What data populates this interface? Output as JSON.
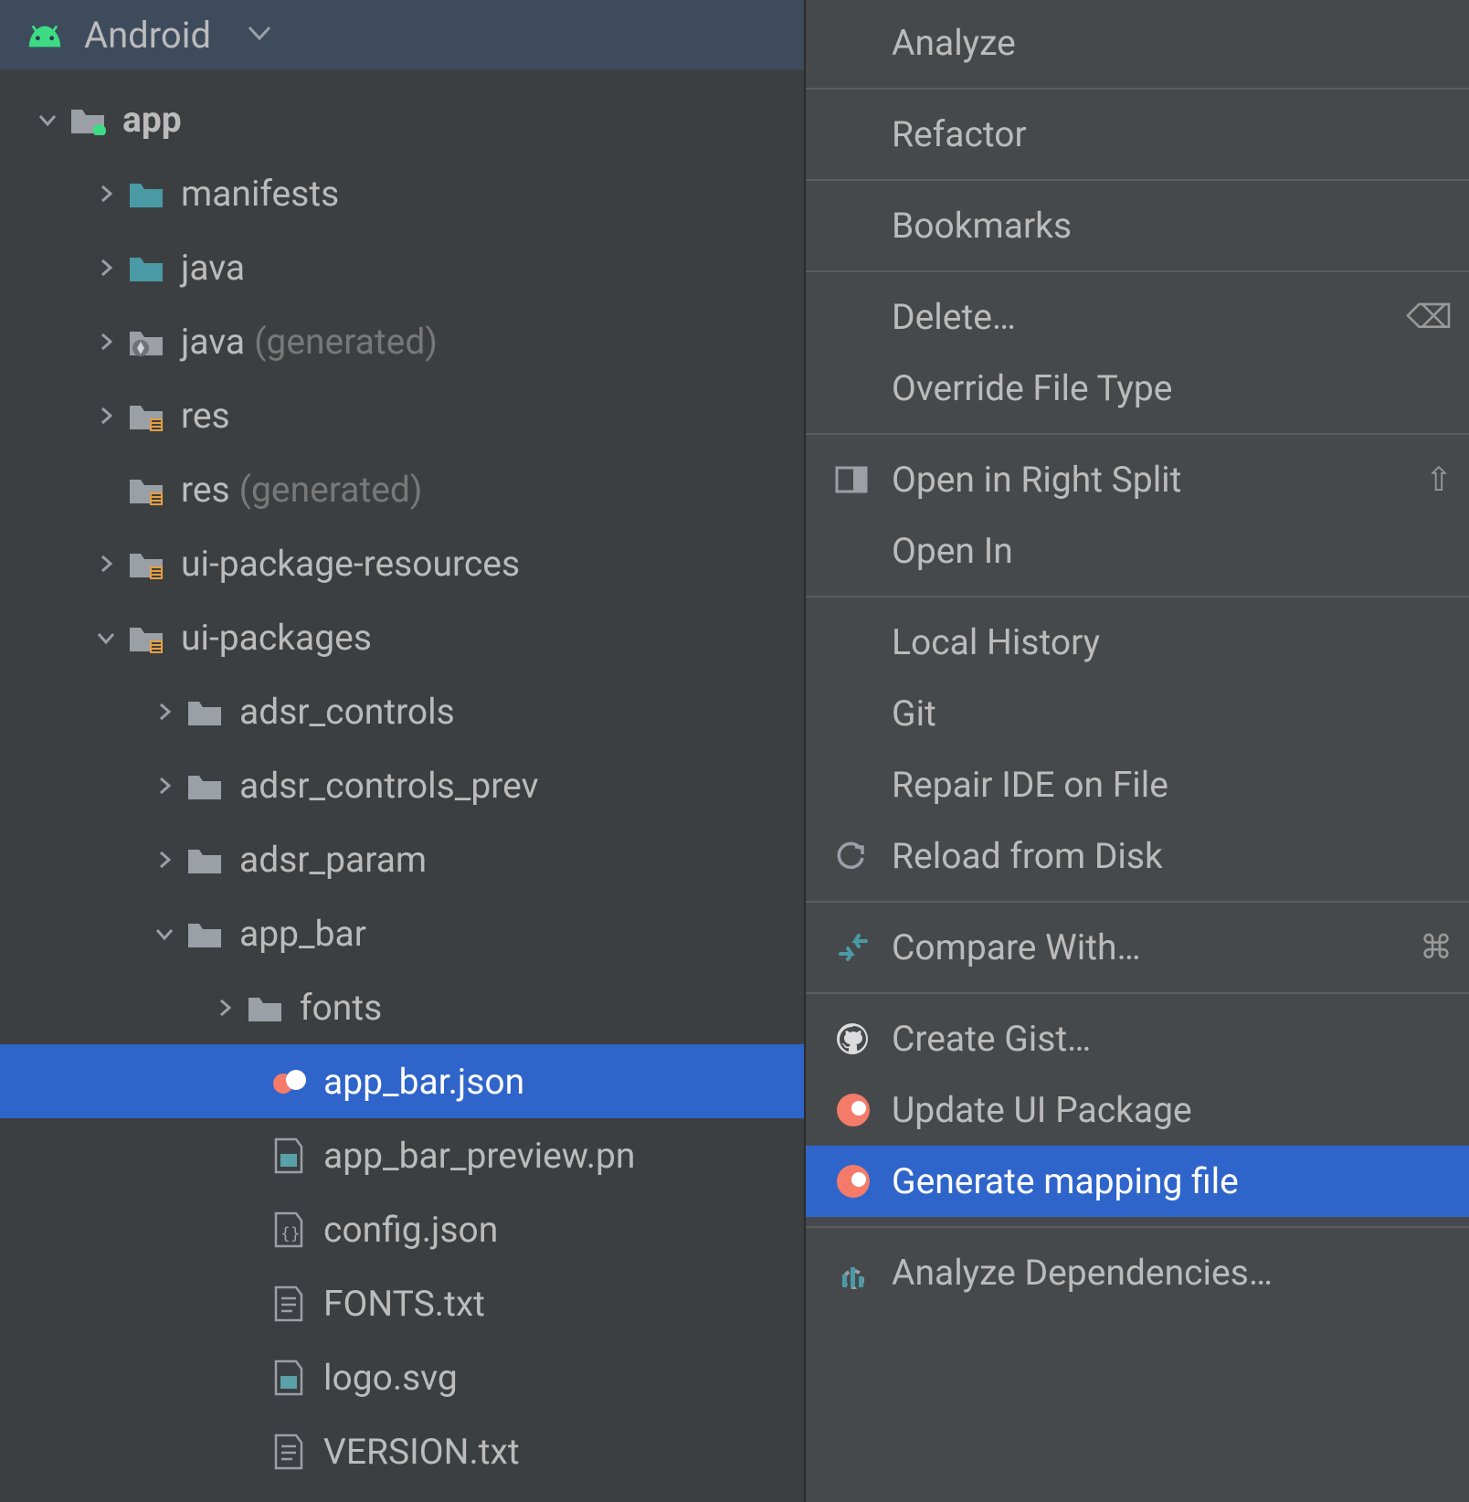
{
  "panel": {
    "title": "Android"
  },
  "tree": {
    "root": {
      "label": "app"
    },
    "manifests": {
      "label": "manifests"
    },
    "java": {
      "label": "java"
    },
    "java_gen": {
      "label": "java",
      "suffix": "(generated)"
    },
    "res": {
      "label": "res"
    },
    "res_gen": {
      "label": "res",
      "suffix": "(generated)"
    },
    "ui_pkg_res": {
      "label": "ui-package-resources"
    },
    "ui_pkg": {
      "label": "ui-packages"
    },
    "adsr_controls": {
      "label": "adsr_controls"
    },
    "adsr_controls_prev": {
      "label": "adsr_controls_prev"
    },
    "adsr_param": {
      "label": "adsr_param"
    },
    "app_bar": {
      "label": "app_bar"
    },
    "fonts": {
      "label": "fonts"
    },
    "app_bar_json": {
      "label": "app_bar.json"
    },
    "app_bar_preview": {
      "label": "app_bar_preview.pn"
    },
    "config_json": {
      "label": "config.json"
    },
    "fonts_txt": {
      "label": "FONTS.txt"
    },
    "logo_svg": {
      "label": "logo.svg"
    },
    "version_txt": {
      "label": "VERSION.txt"
    }
  },
  "menu": {
    "analyze": "Analyze",
    "refactor": "Refactor",
    "bookmarks": "Bookmarks",
    "delete": "Delete…",
    "override_file_type": "Override File Type",
    "open_right_split": "Open in Right Split",
    "open_in": "Open In",
    "local_history": "Local History",
    "git": "Git",
    "repair_ide": "Repair IDE on File",
    "reload_disk": "Reload from Disk",
    "compare_with": "Compare With…",
    "create_gist": "Create Gist…",
    "update_ui_pkg": "Update UI Package",
    "generate_mapping": "Generate mapping file",
    "analyze_deps": "Analyze Dependencies…"
  }
}
